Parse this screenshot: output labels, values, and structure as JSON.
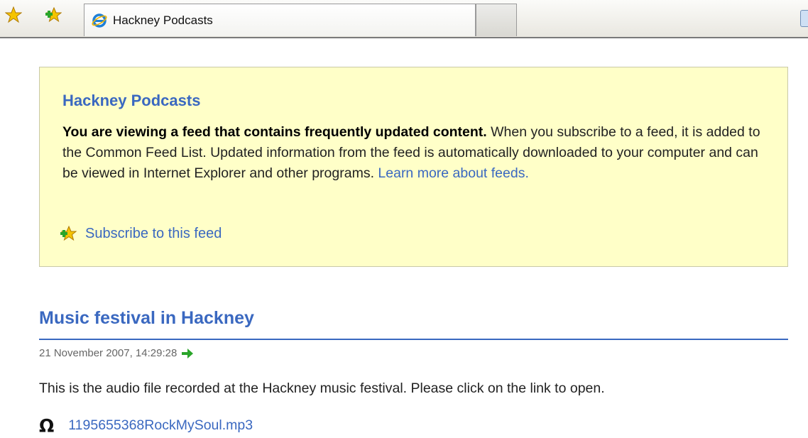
{
  "toolbar": {
    "favorites_icon": "favorites-star-icon",
    "add_favorites_icon": "add-to-favorites-icon",
    "tab_title": "Hackney Podcasts",
    "tab_icon": "internet-explorer-icon"
  },
  "feed": {
    "title": "Hackney Podcasts",
    "notice_bold": "You are viewing a feed that contains frequently updated content.",
    "notice_text": " When you subscribe to a feed, it is added to the Common Feed List. Updated information from the feed is automatically downloaded to your computer and can be viewed in Internet Explorer and other programs. ",
    "learn_more_link": "Learn more about feeds.",
    "subscribe_label": "Subscribe to this feed"
  },
  "item": {
    "title": "Music festival in Hackney",
    "date": "21 November 2007, 14:29:28",
    "body": "This is the audio file recorded at the Hackney music festival. Please click on the link to open.",
    "enclosure_icon": "headphones-icon",
    "enclosure_link": "1195655368RockMySoul.mp3"
  },
  "colors": {
    "link_blue": "#3a68c0",
    "info_box_bg": "#ffffc8",
    "star_gold": "#f0b800",
    "green_arrow": "#2aa52a"
  }
}
